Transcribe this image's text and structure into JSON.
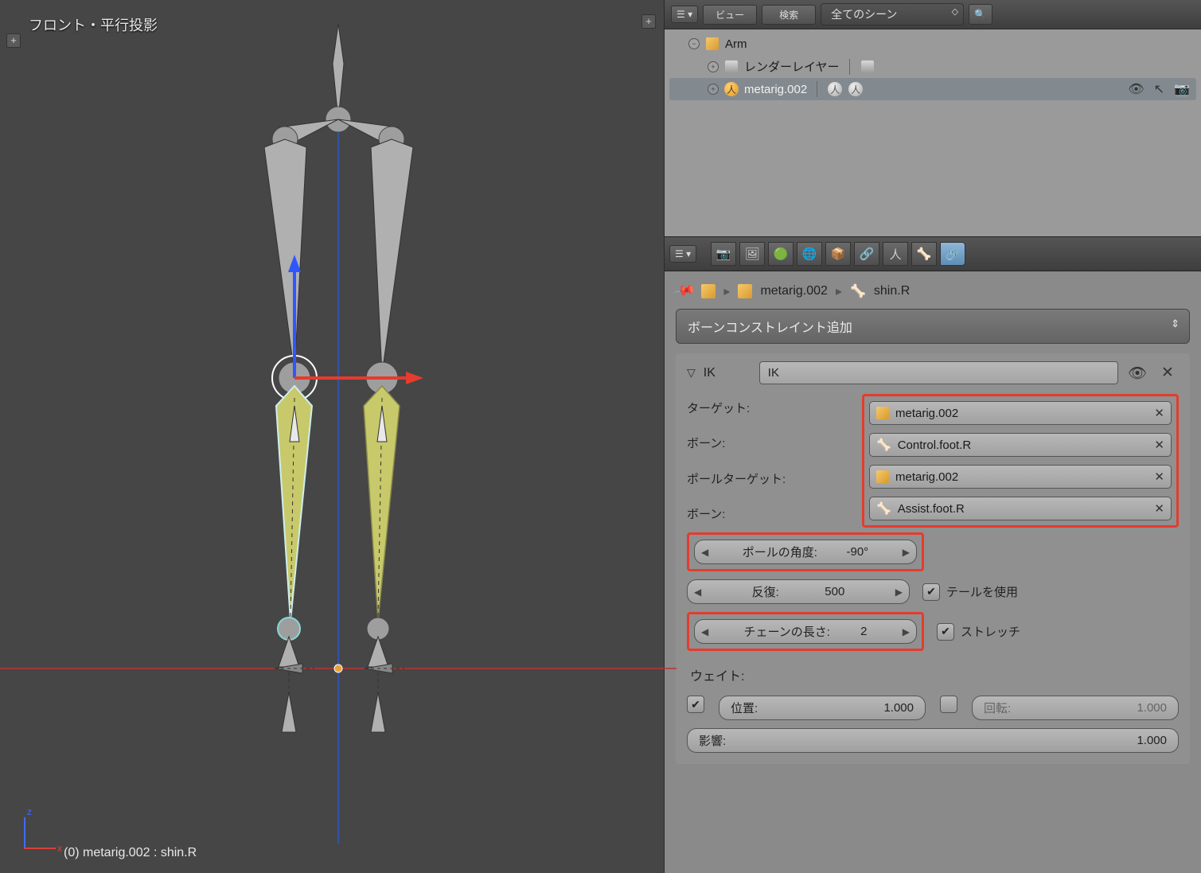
{
  "viewport": {
    "label": "フロント・平行投影",
    "status": "(0) metarig.002 : shin.R",
    "axis_z": "z",
    "axis_x": "x"
  },
  "outliner": {
    "menu_view": "ビュー",
    "menu_search": "検索",
    "scope_dropdown": "全てのシーン",
    "root": "Arm",
    "render_layers": "レンダーレイヤー",
    "armature": "metarig.002"
  },
  "breadcrumb": {
    "object": "metarig.002",
    "bone": "shin.R"
  },
  "bone_constraint": {
    "add_dropdown": "ボーンコンストレイント追加",
    "panel_label": "IK",
    "name_value": "IK",
    "fields": {
      "target_label": "ターゲット:",
      "target_value": "metarig.002",
      "bone1_label": "ボーン:",
      "bone1_value": "Control.foot.R",
      "pole_target_label": "ポールターゲット:",
      "pole_target_value": "metarig.002",
      "bone2_label": "ボーン:",
      "bone2_value": "Assist.foot.R"
    },
    "pole_angle_label": "ポールの角度:",
    "pole_angle_value": "-90°",
    "iterations_label": "反復:",
    "iterations_value": "500",
    "use_tail_label": "テールを使用",
    "chain_length_label": "チェーンの長さ:",
    "chain_length_value": "2",
    "stretch_label": "ストレッチ",
    "weight_heading": "ウェイト:",
    "position_label": "位置:",
    "position_value": "1.000",
    "rotation_label": "回転:",
    "rotation_value": "1.000",
    "influence_label": "影響:",
    "influence_value": "1.000"
  }
}
